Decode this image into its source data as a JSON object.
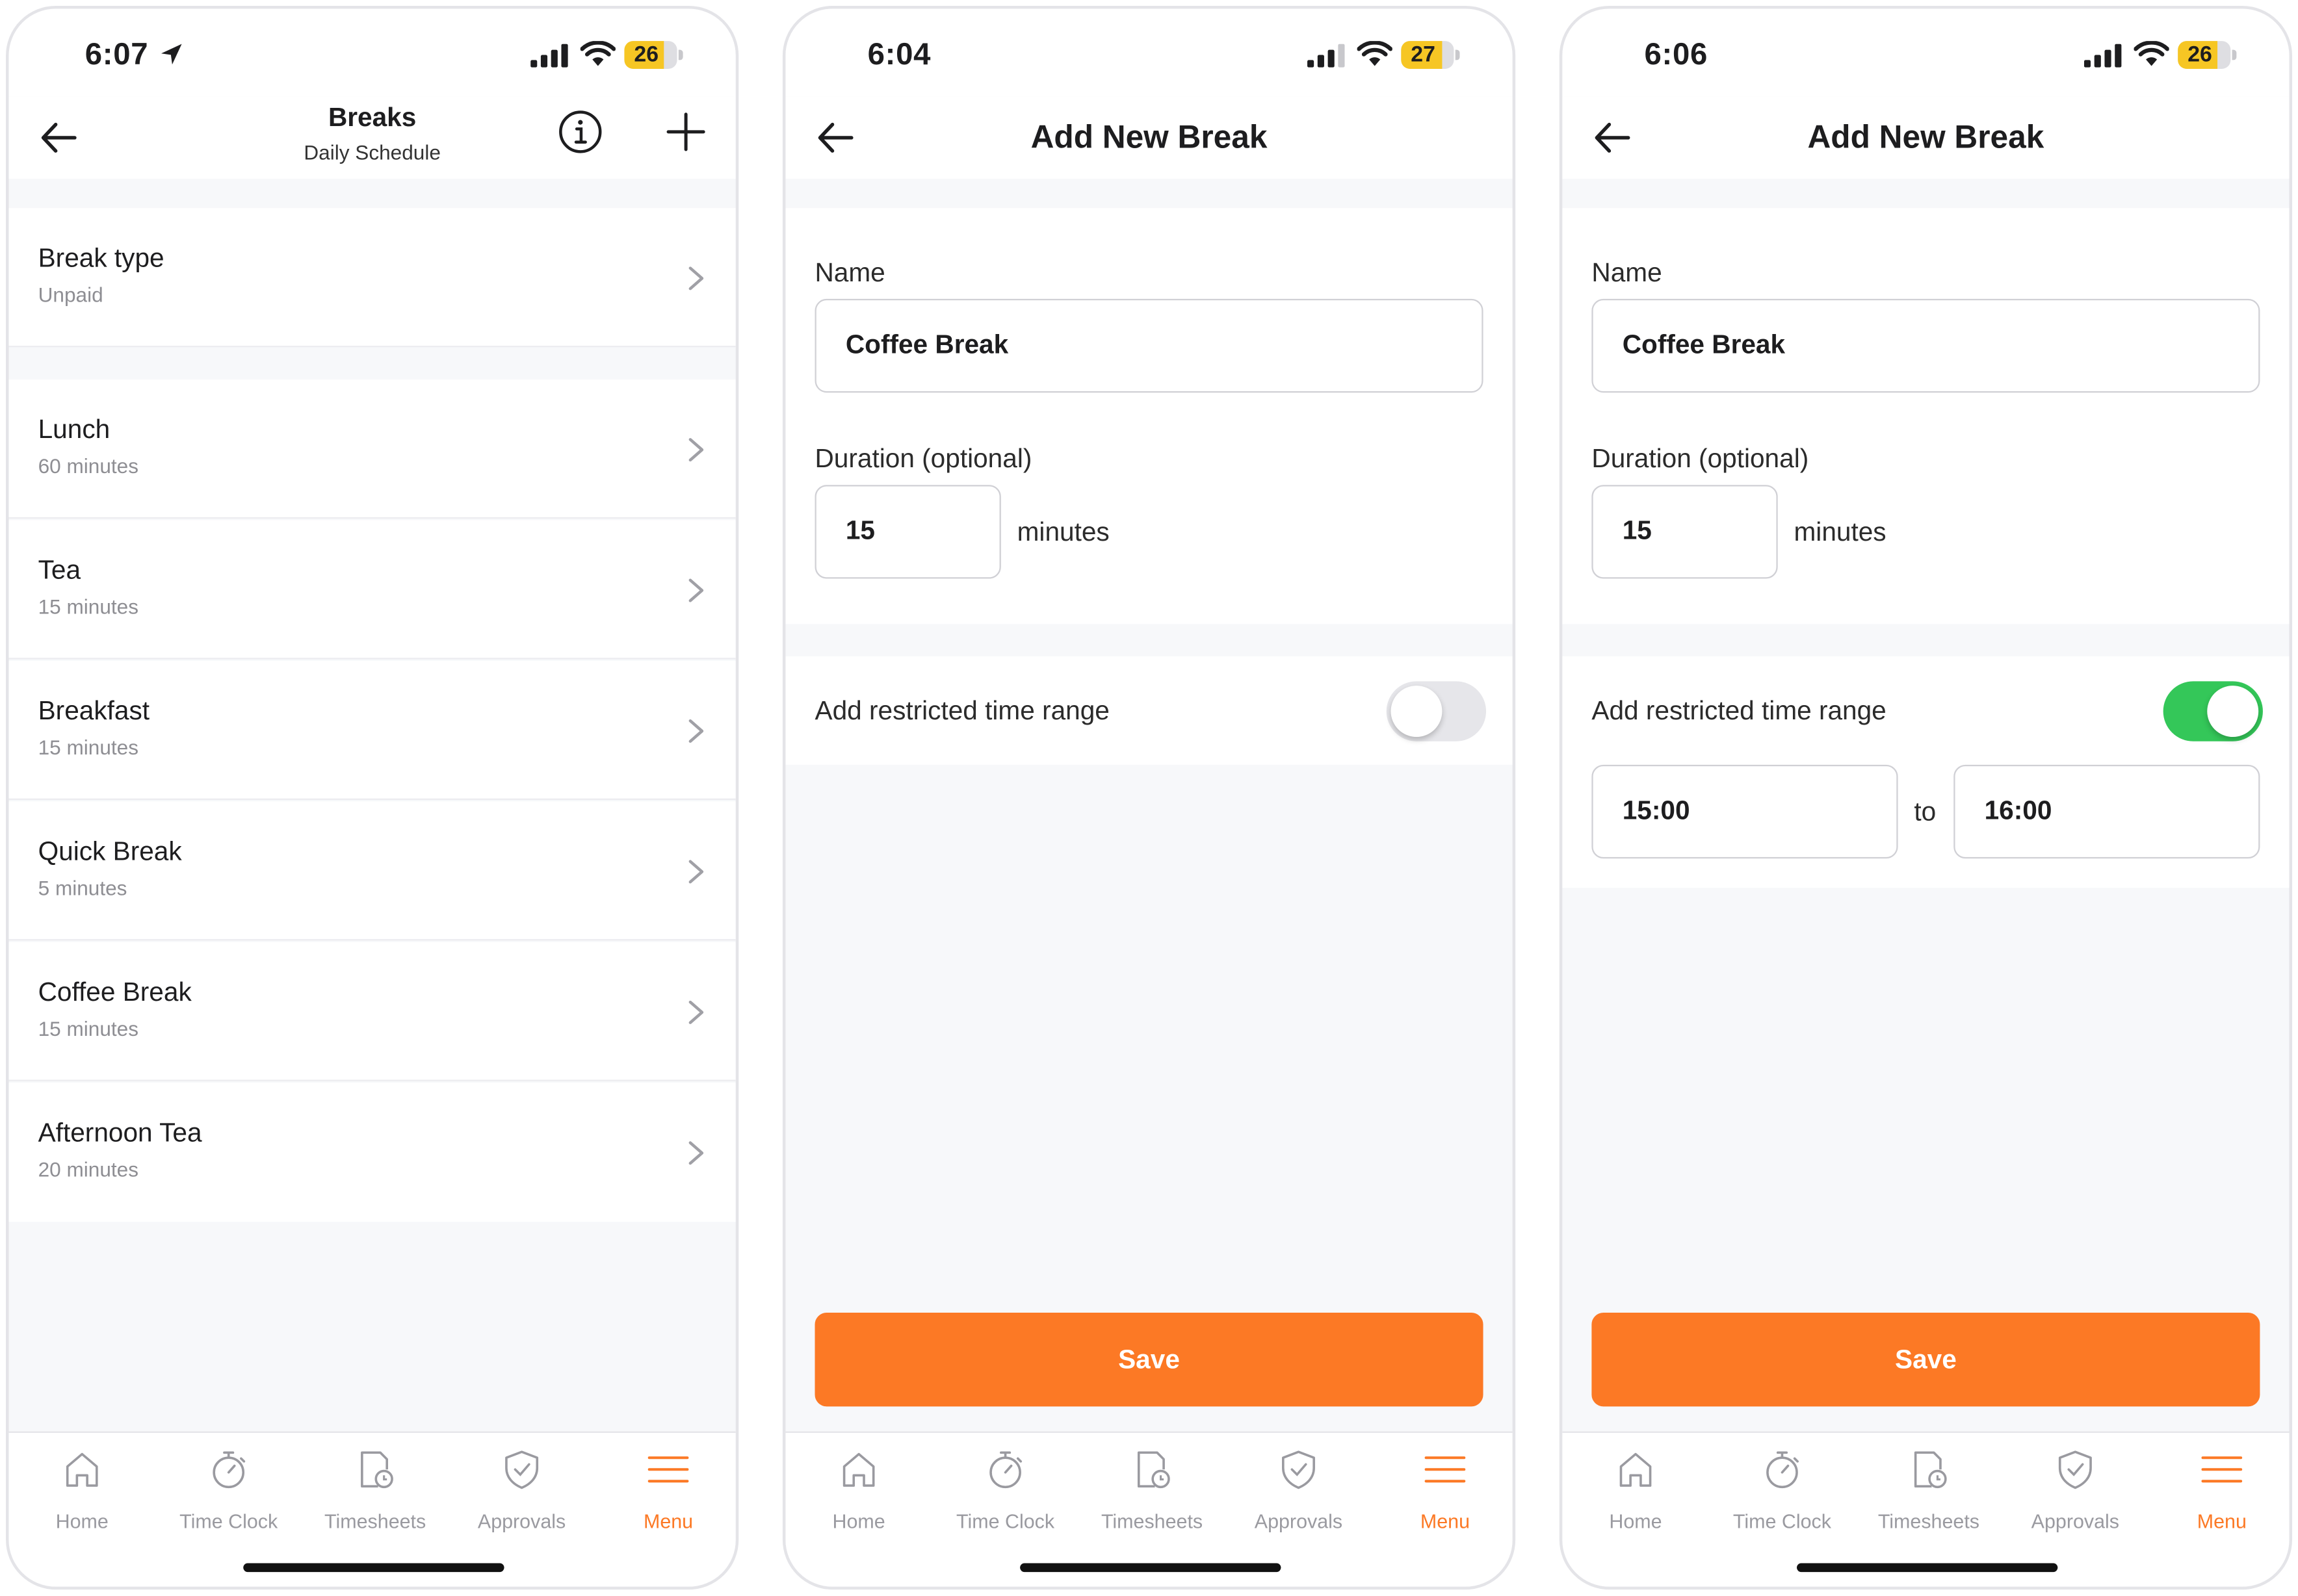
{
  "colors": {
    "accent": "#fc7925",
    "toggle_on": "#34c759",
    "toggle_off": "#e6e6ea"
  },
  "tabbar": {
    "tabs": [
      {
        "label": "Home",
        "icon": "home-icon"
      },
      {
        "label": "Time Clock",
        "icon": "stopwatch-icon"
      },
      {
        "label": "Timesheets",
        "icon": "timesheet-icon"
      },
      {
        "label": "Approvals",
        "icon": "shield-check-icon"
      },
      {
        "label": "Menu",
        "icon": "menu-icon"
      }
    ],
    "active": "Menu"
  },
  "screen1": {
    "status": {
      "time": "6:07",
      "battery": "26"
    },
    "title": "Breaks",
    "subtitle": "Daily Schedule",
    "break_type": {
      "label": "Break type",
      "value": "Unpaid"
    },
    "breaks": [
      {
        "name": "Lunch",
        "duration": "60 minutes"
      },
      {
        "name": "Tea",
        "duration": "15 minutes"
      },
      {
        "name": "Breakfast",
        "duration": "15 minutes"
      },
      {
        "name": "Quick Break",
        "duration": "5 minutes"
      },
      {
        "name": "Coffee Break",
        "duration": "15 minutes"
      },
      {
        "name": "Afternoon Tea",
        "duration": "20 minutes"
      }
    ]
  },
  "screen2": {
    "status": {
      "time": "6:04",
      "battery": "27"
    },
    "title": "Add New Break",
    "name_label": "Name",
    "name_value": "Coffee Break",
    "duration_label": "Duration (optional)",
    "duration_value": "15",
    "duration_unit": "minutes",
    "restrict_label": "Add restricted time range",
    "restrict_on": false,
    "save_label": "Save"
  },
  "screen3": {
    "status": {
      "time": "6:06",
      "battery": "26"
    },
    "title": "Add New Break",
    "name_label": "Name",
    "name_value": "Coffee Break",
    "duration_label": "Duration (optional)",
    "duration_value": "15",
    "duration_unit": "minutes",
    "restrict_label": "Add restricted time range",
    "restrict_on": true,
    "from_time": "15:00",
    "to_label": "to",
    "to_time": "16:00",
    "save_label": "Save"
  }
}
